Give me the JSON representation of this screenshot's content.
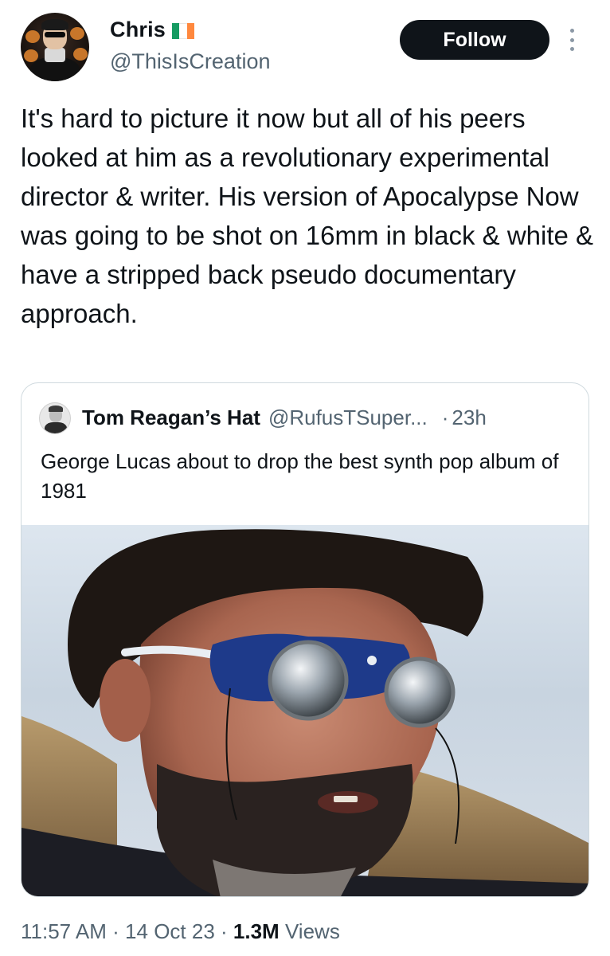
{
  "author": {
    "name": "Chris",
    "handle": "@ThisIsCreation",
    "flag_colors": [
      "#169b62",
      "#ffffff",
      "#ff883e"
    ],
    "avatar_icon": "profile-avatar"
  },
  "follow_button": {
    "label": "Follow"
  },
  "more_menu": {
    "icon": "more-vertical-icon"
  },
  "tweet": {
    "text": "It's hard to picture it now but all of his peers looked at him as a revolutionary experimental director & writer. His version of Apocalypse Now was going to be shot on 16mm in black & white & have a stripped back pseudo documentary approach."
  },
  "quoted_tweet": {
    "author_name": "Tom Reagan’s Hat",
    "author_handle": "@RufusTSuper...",
    "separator": "·",
    "time": "23h",
    "text": "George Lucas about to drop the best synth pop album of 1981",
    "media": "photo"
  },
  "footer": {
    "time": "11:57 AM",
    "sep1": " · ",
    "date": "14 Oct 23",
    "sep2": " · ",
    "views_count": "1.3M",
    "views_label": "Views"
  },
  "colors": {
    "text_primary": "#0f1419",
    "text_secondary": "#536471",
    "border": "#cfd9de",
    "button_bg": "#0f1419"
  }
}
